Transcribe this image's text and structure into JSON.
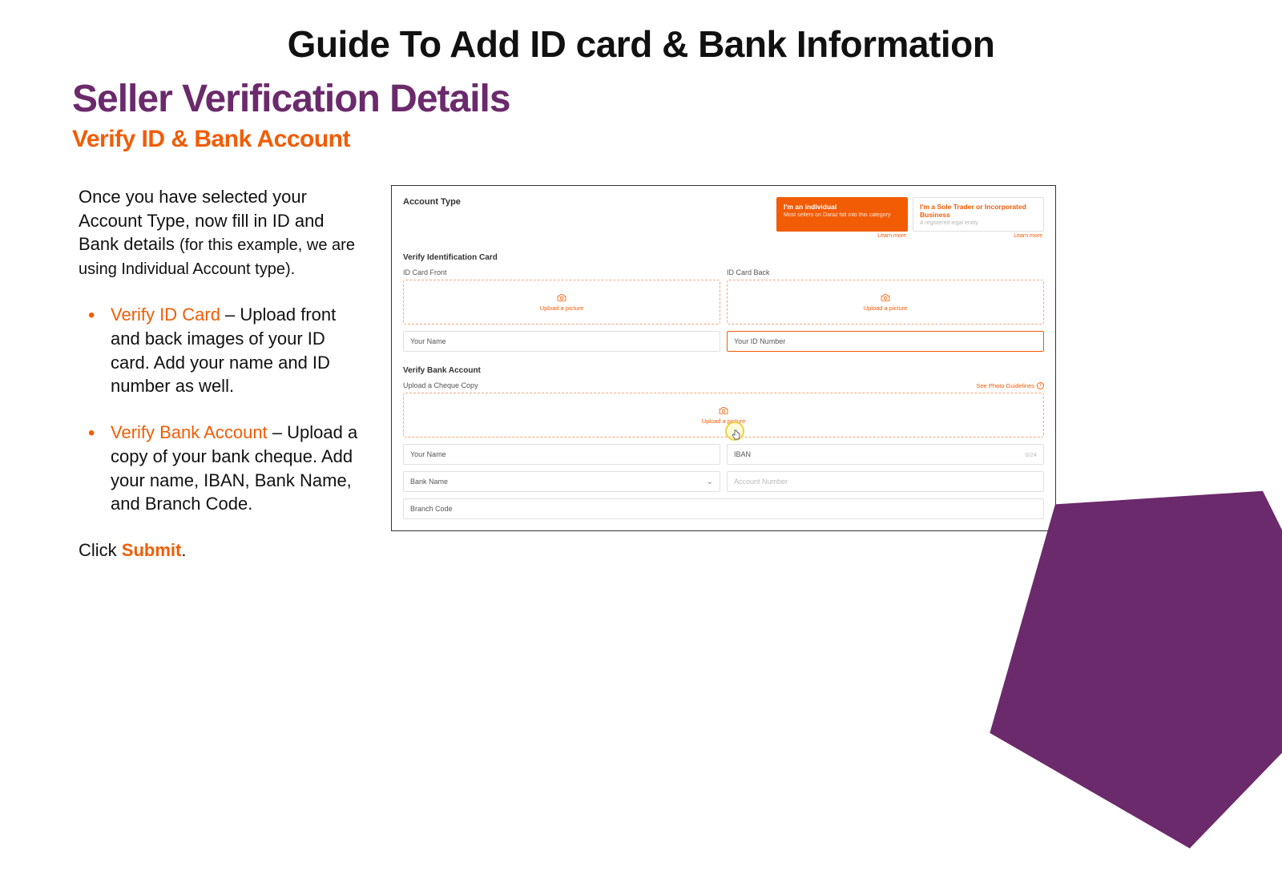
{
  "main_title": "Guide To Add ID card & Bank Information",
  "sub_title": "Seller Verification Details",
  "sub_sub_title": "Verify ID & Bank Account",
  "intro_a": "Once you have selected your Account Type, now fill in ID and Bank details ",
  "intro_b": "(for this example, we are using Individual Account type).",
  "bullets": [
    {
      "head": "Verify ID Card",
      "body": " – Upload front and back images of your ID card. Add your name and ID number as well."
    },
    {
      "head": "Verify Bank Account",
      "body": " – Upload a copy of your bank cheque. Add your name, IBAN, Bank Name, and Branch Code."
    }
  ],
  "click_text": "Click ",
  "submit_text": "Submit",
  "period": ".",
  "shot": {
    "account_type_label": "Account Type",
    "card_individual_title": "I'm an individual",
    "card_individual_sub": "Most sellers on Daraz fall into this category",
    "card_business_title": "I'm a Sole Trader or Incorporated Business",
    "card_business_sub": "A registered legal entity",
    "learn_more": "Learn more",
    "verify_id_section": "Verify Identification Card",
    "id_front_label": "ID Card Front",
    "id_back_label": "ID Card Back",
    "upload_picture": "Upload a picture",
    "your_name": "Your Name",
    "your_id_number": "Your ID Number",
    "verify_bank_section": "Verify Bank Account",
    "cheque_label": "Upload a Cheque Copy",
    "see_guidelines": "See Photo Guidelines",
    "iban": "IBAN",
    "iban_count": "0/24",
    "bank_name": "Bank Name",
    "account_number": "Account Number",
    "branch_code": "Branch Code"
  }
}
